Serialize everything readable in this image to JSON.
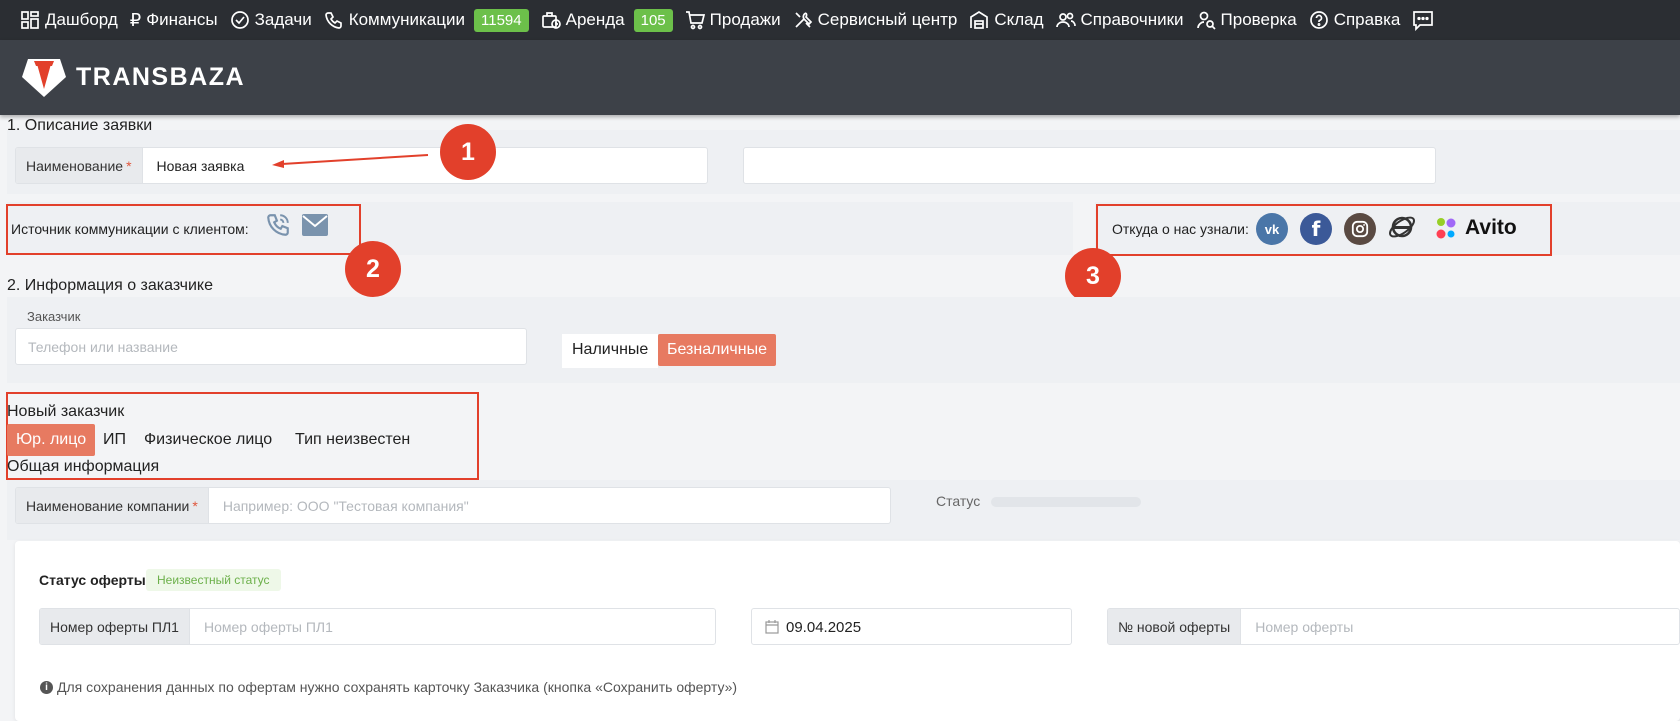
{
  "nav": {
    "items": [
      {
        "icon": "dashboard-icon",
        "label": "Дашборд"
      },
      {
        "icon": "ruble-icon",
        "label": "Финансы"
      },
      {
        "icon": "check-circle-icon",
        "label": "Задачи"
      },
      {
        "icon": "phone-icon",
        "label": "Коммуникации",
        "badge": "11594"
      },
      {
        "icon": "briefcase-clock-icon",
        "label": "Аренда",
        "badge": "105"
      },
      {
        "icon": "cart-icon",
        "label": "Продажи"
      },
      {
        "icon": "tools-icon",
        "label": "Сервисный центр"
      },
      {
        "icon": "warehouse-icon",
        "label": "Склад"
      },
      {
        "icon": "users-icon",
        "label": "Справочники"
      },
      {
        "icon": "user-search-icon",
        "label": "Проверка"
      },
      {
        "icon": "question-icon",
        "label": "Справка"
      }
    ],
    "badge_color": "#6cc04a"
  },
  "header": {
    "logo_text": "TRANSBAZA"
  },
  "section1": {
    "title": "1. Описание заявки",
    "name_label": "Наименование",
    "name_value": "Новая заявка",
    "source_label": "Источник коммуникации с клиентом:",
    "source_icons": [
      "phone-icon",
      "envelope-icon"
    ],
    "referral_label": "Откуда о нас узнали:",
    "referral_icons": [
      "vk-icon",
      "facebook-icon",
      "instagram-icon",
      "internet-explorer-icon"
    ],
    "avito_label": "Avito"
  },
  "section2": {
    "title": "2. Информация о заказчике",
    "customer_label": "Заказчик",
    "customer_placeholder": "Телефон или название",
    "payment": [
      "Наличные",
      "Безналичные"
    ],
    "payment_active": "Безналичные",
    "new_customer_title": "Новый заказчик",
    "customer_types": [
      "Юр. лицо",
      "ИП",
      "Физическое лицо",
      "Тип неизвестен"
    ],
    "customer_type_active": "Юр. лицо",
    "general_info": "Общая информация",
    "company_label": "Наименование компании",
    "company_placeholder": "Например: ООО \"Тестовая компания\"",
    "status_label": "Статус"
  },
  "offer": {
    "status_label": "Статус оферты:",
    "status_badge": "Неизвестный статус",
    "number_label": "Номер оферты ПЛ1",
    "number_placeholder": "Номер оферты ПЛ1",
    "date": "09.04.2025",
    "new_number_label": "№ новой оферты",
    "new_number_placeholder": "Номер оферты",
    "info_text": "Для сохранения данных по офертам нужно сохранять карточку Заказчика (кнопка «Сохранить оферту»)"
  },
  "callouts": [
    "1",
    "2",
    "3"
  ],
  "colors": {
    "accent": "#e77a61",
    "annotation_red": "#e2402b",
    "nav_bg": "#2b2e33",
    "header_bg": "#3d4148"
  }
}
